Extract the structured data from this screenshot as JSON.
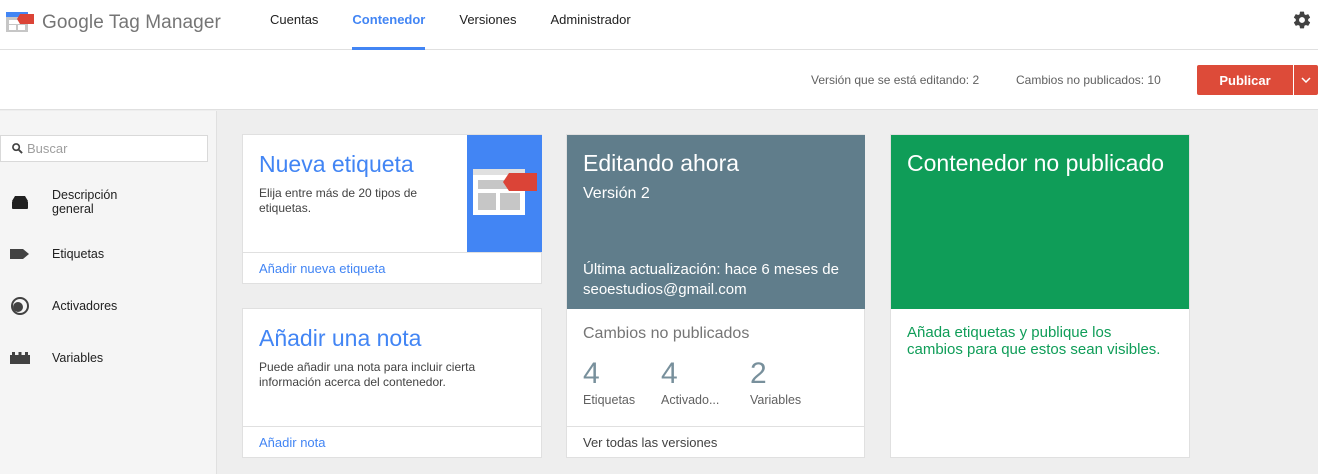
{
  "app": {
    "logo_google": "Google",
    "logo_product": "Tag Manager"
  },
  "nav": {
    "tabs": [
      {
        "label": "Cuentas"
      },
      {
        "label": "Contenedor",
        "active": true
      },
      {
        "label": "Versiones"
      },
      {
        "label": "Administrador"
      }
    ]
  },
  "status": {
    "editing_version": "Versión que se está editando: 2",
    "unpublished_changes": "Cambios no publicados: 10"
  },
  "publish": {
    "label": "Publicar",
    "color": "#dd4b39"
  },
  "sidebar": {
    "search_placeholder": "Buscar",
    "items": [
      {
        "label": "Descripción general",
        "icon": "overview-icon"
      },
      {
        "label": "Etiquetas",
        "icon": "tag-icon"
      },
      {
        "label": "Activadores",
        "icon": "trigger-icon"
      },
      {
        "label": "Variables",
        "icon": "variables-icon"
      }
    ]
  },
  "cards": {
    "new_tag": {
      "title": "Nueva etiqueta",
      "description": "Elija entre más de 20 tipos de etiquetas.",
      "link": "Añadir nueva etiqueta"
    },
    "add_note": {
      "title": "Añadir una nota",
      "description": "Puede añadir una nota para incluir cierta información acerca del contenedor.",
      "link": "Añadir nota"
    },
    "editing": {
      "title": "Editando ahora",
      "version": "Versión 2",
      "last_update": "Última actualización: hace 6 meses de seoestudios@gmail.com",
      "changes_title": "Cambios no publicados",
      "counts": [
        {
          "value": "4",
          "label": "Etiquetas"
        },
        {
          "value": "4",
          "label": "Activado..."
        },
        {
          "value": "2",
          "label": "Variables"
        }
      ],
      "link": "Ver todas las versiones",
      "color": "#607d8b"
    },
    "unpublished": {
      "title": "Contenedor no publicado",
      "description": "Añada etiquetas y publique los cambios para que estos sean visibles.",
      "color": "#0f9d58"
    }
  },
  "colors": {
    "accent": "#4285f4",
    "publish": "#dd4b39",
    "editing": "#607d8b",
    "unpublished": "#0f9d58"
  }
}
